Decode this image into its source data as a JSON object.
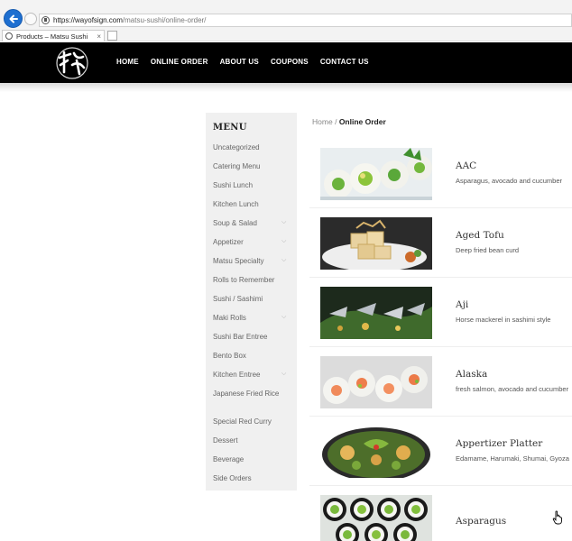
{
  "browser": {
    "url_host": "https://wayofsign.com",
    "url_path": "/matsu-sushi/online-order/",
    "tab_title": "Products – Matsu Sushi"
  },
  "header": {
    "nav": [
      "HOME",
      "ONLINE ORDER",
      "ABOUT US",
      "COUPONS",
      "CONTACT US"
    ]
  },
  "sidebar": {
    "title": "MENU",
    "items": [
      {
        "label": "Uncategorized",
        "has_children": false
      },
      {
        "label": "Catering Menu",
        "has_children": false
      },
      {
        "label": "Sushi Lunch",
        "has_children": false
      },
      {
        "label": "Kitchen Lunch",
        "has_children": false
      },
      {
        "label": "Soup & Salad",
        "has_children": true
      },
      {
        "label": "Appetizer",
        "has_children": true
      },
      {
        "label": "Matsu Specialty",
        "has_children": true
      },
      {
        "label": "Rolls to Remember",
        "has_children": false
      },
      {
        "label": "Sushi / Sashimi",
        "has_children": false
      },
      {
        "label": "Maki Rolls",
        "has_children": true
      },
      {
        "label": "Sushi Bar Entree",
        "has_children": false
      },
      {
        "label": "Bento Box",
        "has_children": false
      },
      {
        "label": "Kitchen Entree",
        "has_children": true
      },
      {
        "label": "Japanese Fried Rice",
        "has_children": false
      },
      {
        "label": "Special Red Curry",
        "has_children": false
      },
      {
        "label": "Dessert",
        "has_children": false
      },
      {
        "label": "Beverage",
        "has_children": false
      },
      {
        "label": "Side Orders",
        "has_children": false
      }
    ]
  },
  "breadcrumb": {
    "home": "Home",
    "separator": "/",
    "current": "Online Order"
  },
  "products": [
    {
      "name": "AAC",
      "desc": "Asparagus, avocado and cucumber"
    },
    {
      "name": "Aged Tofu",
      "desc": "Deep fried bean curd"
    },
    {
      "name": "Aji",
      "desc": "Horse mackerel in sashimi style"
    },
    {
      "name": "Alaska",
      "desc": "fresh salmon, avocado and cucumber"
    },
    {
      "name": "Appertizer Platter",
      "desc": "Edamame, Harumaki, Shumai, Gyoza"
    },
    {
      "name": "Asparagus",
      "desc": ""
    }
  ],
  "colors": {
    "header_bg": "#000000",
    "sidebar_bg": "#f0f0f0",
    "back_button": "#1e6fd0"
  }
}
